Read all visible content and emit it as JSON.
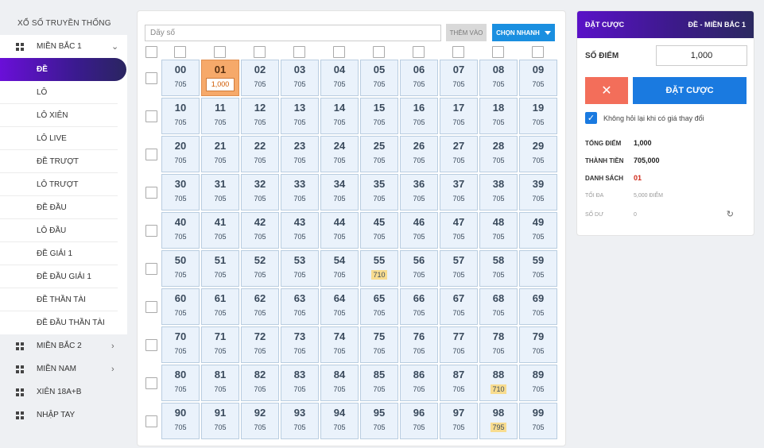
{
  "sidebar": {
    "title": "XỔ SỐ TRUYỀN THỐNG",
    "groups": [
      {
        "label": "MIỀN BẮC 1",
        "chevron": "⌄"
      },
      {
        "label": "MIỀN BẮC 2",
        "chevron": "›"
      },
      {
        "label": "MIỀN NAM",
        "chevron": "›"
      },
      {
        "label": "XIÊN 18A+B",
        "chevron": ""
      },
      {
        "label": "NHẬP TAY",
        "chevron": ""
      }
    ],
    "items": [
      "ĐỀ",
      "LÔ",
      "LÔ XIÊN",
      "LÔ LIVE",
      "ĐỀ TRƯỢT",
      "LÔ TRƯỢT",
      "ĐỀ ĐẦU",
      "LÔ ĐẦU",
      "ĐỀ GIẢI 1",
      "ĐỀ ĐẦU GIẢI 1",
      "ĐỀ THẦN TÀI",
      "ĐỀ ĐẦU THẦN TÀI"
    ],
    "active_item": 0
  },
  "toolbar": {
    "sequence_placeholder": "Dãy số",
    "add_label": "THÊM VÀO",
    "quick_label": "CHỌN NHANH"
  },
  "grid": {
    "default_odd": "705",
    "special_odds": {
      "55": "710",
      "88": "710",
      "98": "795"
    },
    "selected": {
      "01": "1,000"
    }
  },
  "panel": {
    "title": "ĐẶT CƯỢC",
    "subtitle": "ĐỀ - MIỀN BẮC 1",
    "points_label": "SỐ ĐIỂM",
    "points_value": "1,000",
    "cancel_label": "✕",
    "bet_label": "ĐẶT CƯỢC",
    "confirm_text": "Không hỏi lại khi có giá thay đổi",
    "summary": {
      "total_points_label": "TỔNG ĐIỂM",
      "total_points": "1,000",
      "amount_label": "THÀNH TIỀN",
      "amount": "705,000",
      "list_label": "DANH SÁCH",
      "list": "01",
      "max_label": "TỐI ĐA",
      "max": "5,000 ĐIỂM",
      "balance_label": "SỐ DƯ",
      "balance": "0"
    }
  }
}
